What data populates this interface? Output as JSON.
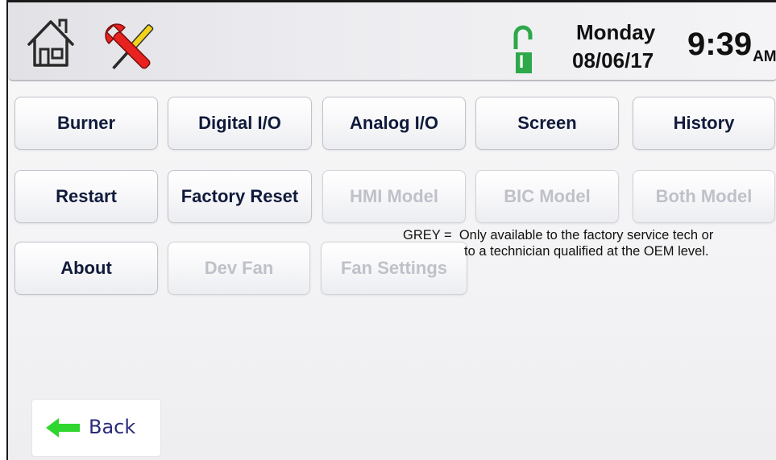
{
  "header": {
    "icons": [
      "home-icon",
      "tools-icon",
      "unlocked-padlock-icon"
    ],
    "lock_badge": "I",
    "day": "Monday",
    "date": "08/06/17",
    "time": "9:39",
    "ampm": "AM"
  },
  "rows": [
    [
      {
        "label": "Burner",
        "enabled": true
      },
      {
        "label": "Digital I/O",
        "enabled": true
      },
      {
        "label": "Analog I/O",
        "enabled": true
      },
      {
        "label": "Screen",
        "enabled": true
      },
      {
        "label": "History",
        "enabled": true
      }
    ],
    [
      {
        "label": "Restart",
        "enabled": true
      },
      {
        "label": "Factory Reset",
        "enabled": true
      },
      {
        "label": "HMI Model",
        "enabled": false
      },
      {
        "label": "BIC Model",
        "enabled": false
      },
      {
        "label": "Both Model",
        "enabled": false
      }
    ],
    [
      {
        "label": "About",
        "enabled": true
      },
      {
        "label": "Dev Fan",
        "enabled": false
      },
      {
        "label": "Fan Settings",
        "enabled": false
      }
    ]
  ],
  "note": {
    "line1": "GREY =  Only available to the factory service tech or",
    "line2": "to a technician qualified at the OEM level."
  },
  "back": {
    "label": "Back"
  },
  "colors": {
    "enabled_text": "#101a3a",
    "disabled_text": "#bfc1c9",
    "lock_green": "#2ea84a",
    "arrow_green": "#2fd62f",
    "wrench_red": "#e8231f",
    "screwdriver_yellow": "#f2d21b"
  }
}
